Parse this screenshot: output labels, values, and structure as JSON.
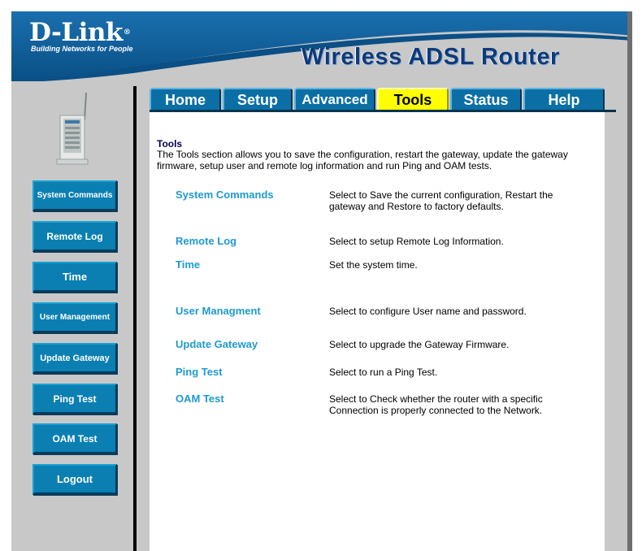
{
  "header": {
    "logo": "D-Link",
    "logo_mark": "®",
    "tagline": "Building Networks for People",
    "product_title": "Wireless ADSL Router"
  },
  "tabs": [
    {
      "label": "Home",
      "active": false
    },
    {
      "label": "Setup",
      "active": false
    },
    {
      "label": "Advanced",
      "active": false
    },
    {
      "label": "Tools",
      "active": true
    },
    {
      "label": "Status",
      "active": false
    },
    {
      "label": "Help",
      "active": false
    }
  ],
  "sidebar": {
    "items": [
      {
        "label": "System Commands"
      },
      {
        "label": "Remote Log"
      },
      {
        "label": "Time"
      },
      {
        "label": "User Management"
      },
      {
        "label": "Update Gateway"
      },
      {
        "label": "Ping Test"
      },
      {
        "label": "OAM Test"
      },
      {
        "label": "Logout"
      }
    ]
  },
  "main": {
    "title": "Tools",
    "description": "The Tools section allows you to save the configuration, restart the gateway, update the gateway firmware, setup user and remote log information and run Ping and OAM tests.",
    "items": [
      {
        "label": "System Commands",
        "desc": "Select to Save the current configuration, Restart the gateway and Restore to factory defaults."
      },
      {
        "label": "Remote Log",
        "desc": "Select to setup Remote Log Information."
      },
      {
        "label": "Time",
        "desc": "Set the system time."
      },
      {
        "label": "User Managment",
        "desc": "Select to configure User name and password."
      },
      {
        "label": "Update Gateway",
        "desc": "Select to upgrade the Gateway Firmware."
      },
      {
        "label": "Ping Test",
        "desc": "Select to run a Ping Test."
      },
      {
        "label": "OAM Test",
        "desc": "Select to Check whether the router with a specific Connection is properly connected to the Network."
      }
    ]
  },
  "colors": {
    "header_blue": "#0a5e96",
    "nav_button": "#0b7fb2",
    "active_tab": "#ffff00",
    "link": "#1e9ad0",
    "frame_gray": "#c8c8c8"
  }
}
